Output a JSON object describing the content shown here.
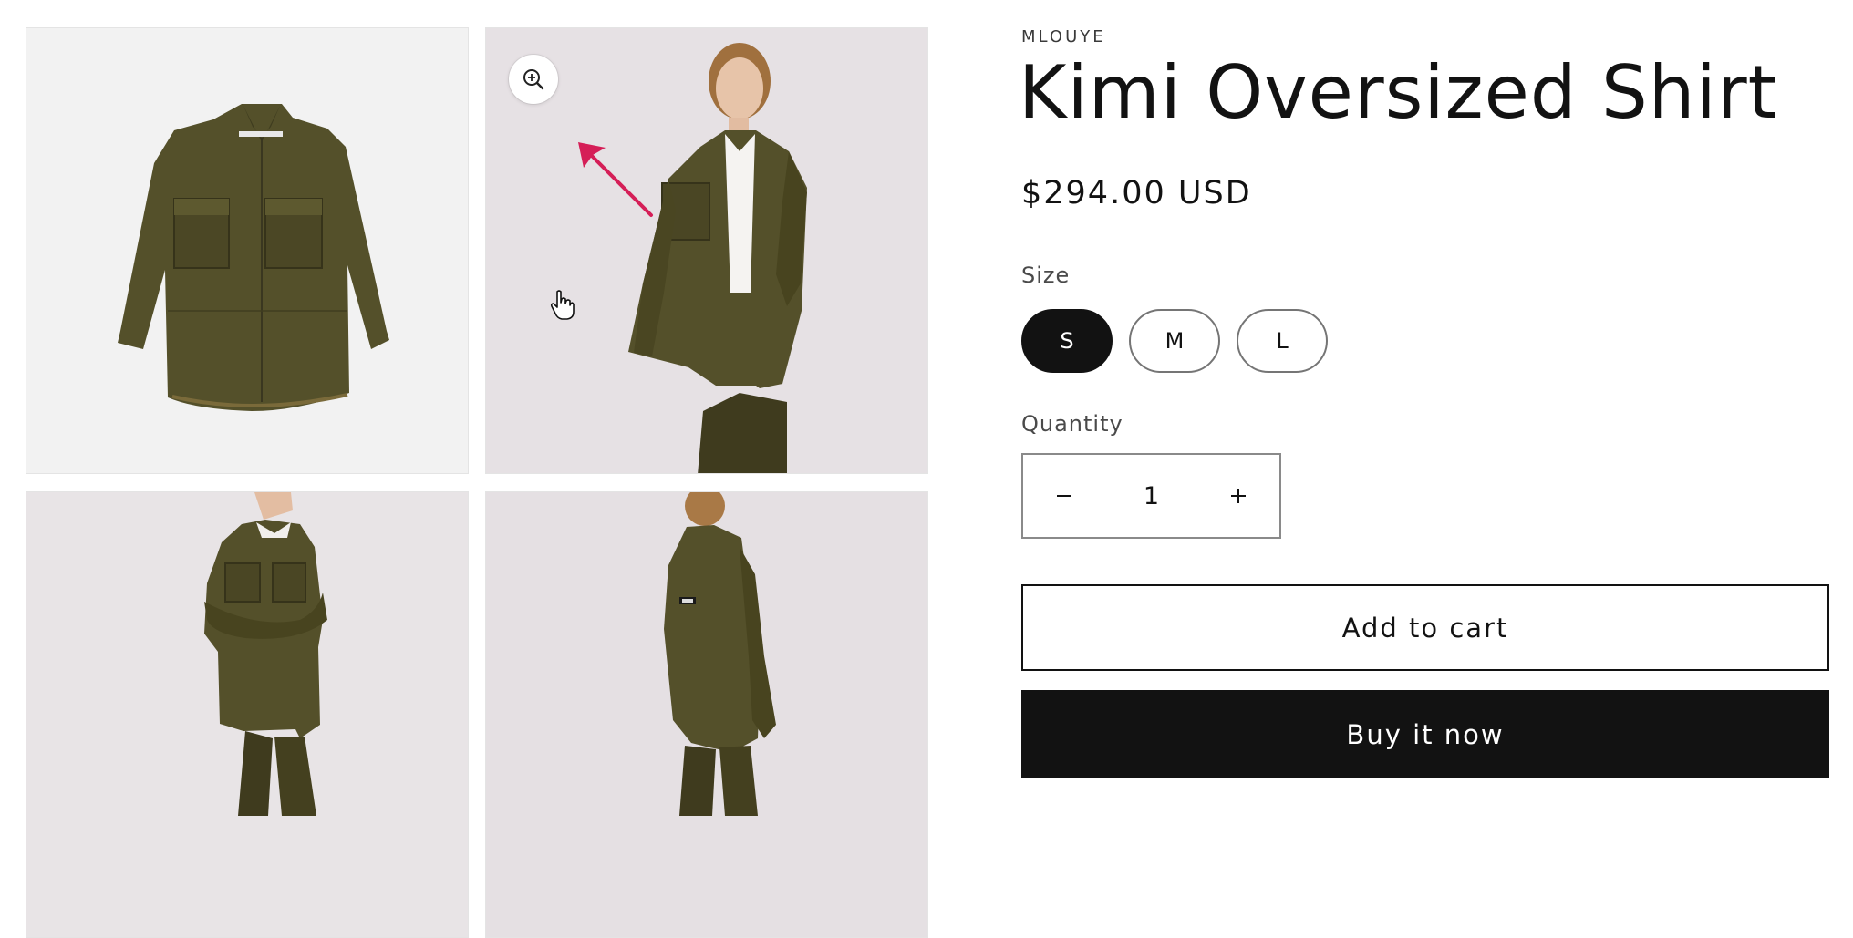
{
  "product": {
    "vendor": "MLOUYE",
    "title": "Kimi Oversized Shirt",
    "price": "$294.00 USD"
  },
  "gallery": {
    "images": [
      {
        "icon": "shirt-flatlay-photo"
      },
      {
        "icon": "model-front-photo"
      },
      {
        "icon": "model-arms-crossed-photo"
      },
      {
        "icon": "model-back-photo"
      }
    ],
    "zoom_icon": "zoom-in-icon"
  },
  "size": {
    "label": "Size",
    "options": [
      "S",
      "M",
      "L"
    ],
    "selected": "S"
  },
  "quantity": {
    "label": "Quantity",
    "value": "1",
    "decrease_icon": "minus-icon",
    "increase_icon": "plus-icon"
  },
  "buttons": {
    "add_to_cart": "Add to cart",
    "buy_now": "Buy it now"
  },
  "colors": {
    "leather": "#54502a",
    "annotation": "#d51e57",
    "primary": "#121212"
  }
}
